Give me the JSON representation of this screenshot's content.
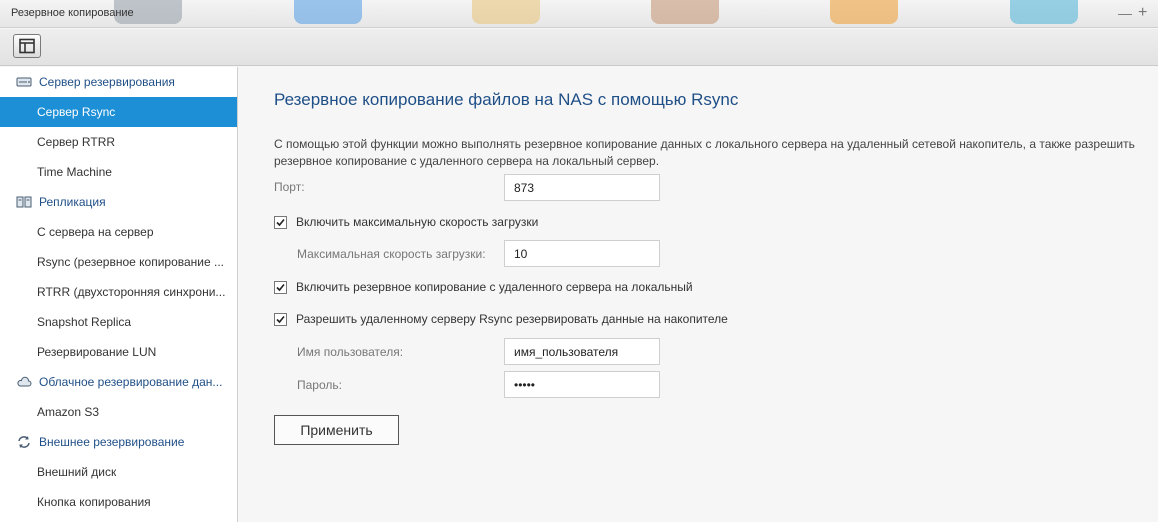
{
  "window": {
    "title": "Резервное копирование"
  },
  "sidebar": {
    "items": [
      {
        "kind": "group",
        "label": "Сервер резервирования",
        "icon": "server-icon"
      },
      {
        "kind": "sub",
        "label": "Сервер Rsync",
        "active": true
      },
      {
        "kind": "sub",
        "label": "Сервер RTRR"
      },
      {
        "kind": "sub",
        "label": "Time Machine"
      },
      {
        "kind": "group",
        "label": "Репликация",
        "icon": "replication-icon"
      },
      {
        "kind": "sub",
        "label": "С сервера на сервер"
      },
      {
        "kind": "sub",
        "label": "Rsync (резервное копирование ..."
      },
      {
        "kind": "sub",
        "label": "RTRR (двухсторонняя синхрони..."
      },
      {
        "kind": "sub",
        "label": "Snapshot Replica"
      },
      {
        "kind": "sub",
        "label": "Резервирование LUN"
      },
      {
        "kind": "group",
        "label": "Облачное резервирование дан...",
        "icon": "cloud-icon"
      },
      {
        "kind": "sub",
        "label": "Amazon S3"
      },
      {
        "kind": "group",
        "label": "Внешнее резервирование",
        "icon": "sync-icon"
      },
      {
        "kind": "sub",
        "label": "Внешний диск"
      },
      {
        "kind": "sub",
        "label": "Кнопка копирования"
      }
    ]
  },
  "main": {
    "title": "Резервное копирование файлов на NAS с помощью Rsync",
    "description": "С помощью этой функции можно выполнять резервное копирование данных с локального сервера на удаленный сетевой накопитель, а также разрешить резервное копирование с удаленного сервера на локальный сервер.",
    "port": {
      "label": "Порт:",
      "value": "873"
    },
    "max_speed_check": {
      "label": "Включить максимальную скорость загрузки",
      "checked": true
    },
    "max_speed": {
      "label": "Максимальная скорость загрузки:",
      "value": "10"
    },
    "remote_to_local_check": {
      "label": "Включить резервное копирование с удаленного сервера на локальный",
      "checked": true
    },
    "allow_remote_check": {
      "label": "Разрешить удаленному серверу Rsync резервировать данные на накопителе",
      "checked": true
    },
    "username": {
      "label": "Имя пользователя:",
      "value": "имя_пользователя"
    },
    "password": {
      "label": "Пароль:",
      "value": "*****"
    },
    "apply_label": "Применить"
  },
  "colors": {
    "accent": "#1d8fd6",
    "heading": "#1f4f87"
  }
}
